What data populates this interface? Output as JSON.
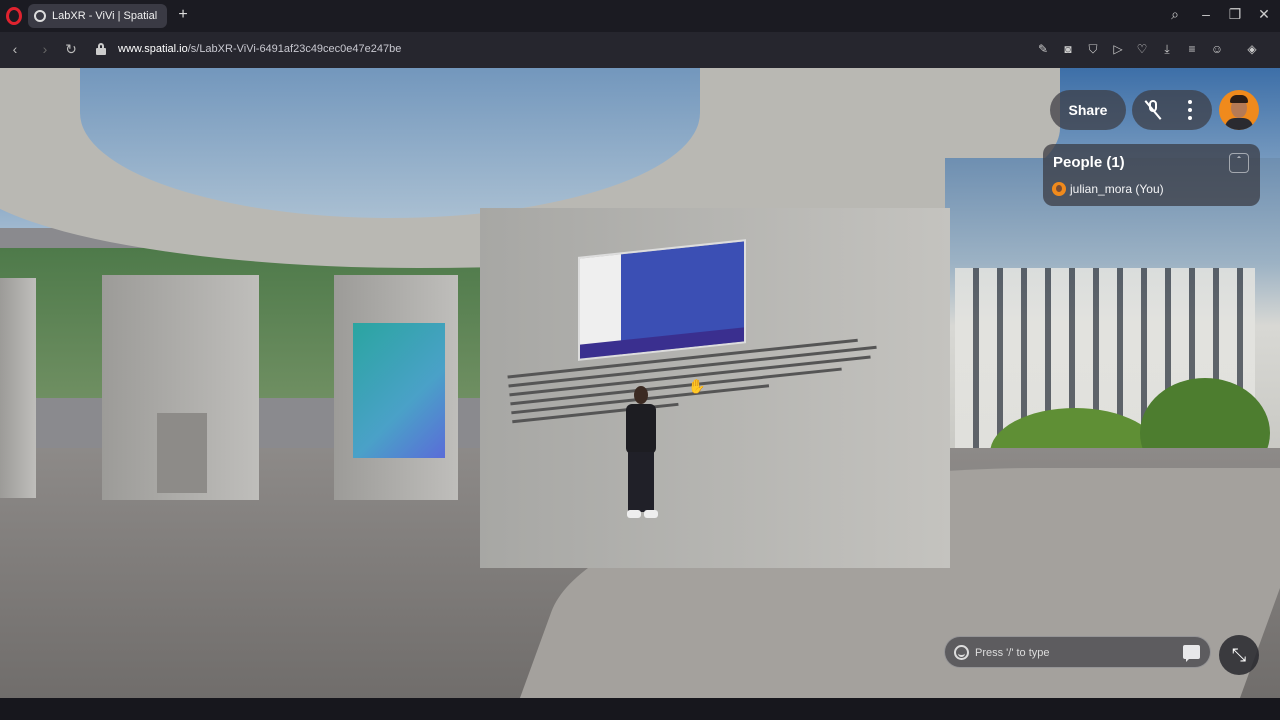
{
  "browser": {
    "tab_title": "LabXR - ViVi | Spatial",
    "new_tab_icon": "plus-icon",
    "url_host": "www.spatial.io",
    "url_path": "/s/LabXR-ViVi-6491af23c49cec0e47e247be"
  },
  "space": {
    "share_label": "Share",
    "people_title": "People (1)",
    "people": [
      {
        "name": "julian_mora (You)"
      }
    ],
    "chat_placeholder": "Press '/' to type"
  },
  "colors": {
    "browser_logo": "#e0232f",
    "avatar_bg": "#f08a1c"
  }
}
